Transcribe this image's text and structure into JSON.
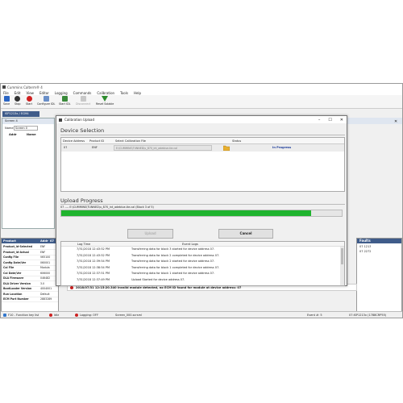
{
  "app": {
    "title": "Cummins Calterm® 4",
    "menu": [
      "File",
      "Edit",
      "View",
      "Editor",
      "Logging",
      "Commands",
      "Calibration",
      "Tools",
      "Help"
    ],
    "toolbar": [
      {
        "label": "Save",
        "color": "#2c66c4"
      },
      {
        "label": "Stop",
        "color": "#333333"
      },
      {
        "label": "Start",
        "color": "#d02020"
      },
      {
        "label": "Configure IDL",
        "color": "#6a8fc8"
      },
      {
        "label": "Start IDL",
        "color": "#3a8a3a"
      },
      {
        "label": "Disconnect",
        "color": "#b0b0b0"
      },
      {
        "label": "Reset Solable",
        "color": "#2e8b2e"
      }
    ]
  },
  "connection_tab": "ISP1213x / ECM4",
  "screen_panel": {
    "tab": "Screen 4",
    "name_label": "Name",
    "name_value": "Screen 0",
    "col_addr": "Addr",
    "col_name": "Name"
  },
  "product_panel": {
    "header_left": "Product",
    "header_addr": "Addr",
    "header_val": "07",
    "rows": [
      {
        "k": "Product_Id-Selected",
        "v": "ENF"
      },
      {
        "k": "Product_Id-Actual",
        "v": "ENF"
      },
      {
        "k": "Config File",
        "v": "V65100"
      },
      {
        "k": "Config Date/Ver",
        "v": "060001"
      },
      {
        "k": "Cal File",
        "v": "Modula"
      },
      {
        "k": "Cal Date/Ver",
        "v": "606000"
      },
      {
        "k": "DLA Firmware",
        "v": "046482"
      },
      {
        "k": "DLA Driver Version",
        "v": "3.0"
      },
      {
        "k": "BootLoader Version",
        "v": "4004001"
      },
      {
        "k": "Run Location",
        "v": "Default"
      },
      {
        "k": "ECM Part Number",
        "v": "2883289"
      }
    ]
  },
  "faults": {
    "title": "Faults",
    "items": [
      "07 1213",
      "07 2272"
    ]
  },
  "event_strip": "2018/07/31 12:15:20.340   Invalid module detected, no ECM ID found for module at device address: 07",
  "status_bar": {
    "help": "F10 - Function key list",
    "idle": "Idle",
    "logging": "Logging: OFF",
    "screen": "Screen_000.scrsml",
    "event": "Event #: 5",
    "right": "07:ISP1213x (1788CRP55)"
  },
  "dialog": {
    "title": "Calibration Upload",
    "device_section": "Device Selection",
    "columns": [
      "Device Address",
      "Product ID",
      "Select Calibration File",
      "Status"
    ],
    "row": {
      "address": "07",
      "product": "ENF",
      "file": "E:\\CUMMINS\\TUNNED\\u_870_int_adeblue-tie.cal",
      "status": "In Progress"
    },
    "upload_section": "Upload Progress",
    "progress_text": "07 ---- E:\\CUMMINS\\TUNNED\\u_870_int_adeblue-tie.cal (Block 3 of 5)",
    "progress": 0.89,
    "upload_btn": "Upload",
    "cancel_btn": "Cancel",
    "log_headers": [
      "Log Time",
      "Event Logs"
    ],
    "logs": [
      {
        "t": "7/31/2018 12:43:52 PM",
        "e": "Transferring data for block 3 started for device address 07."
      },
      {
        "t": "7/31/2018 12:43:52 PM",
        "e": "Transferring data for block 2 completed for device address 07."
      },
      {
        "t": "7/31/2018 12:39:54 PM",
        "e": "Transferring data for block 2 started for device address 07."
      },
      {
        "t": "7/31/2018 12:38:54 PM",
        "e": "Transferring data for block 1 completed for device address 07."
      },
      {
        "t": "7/31/2018 12:37:51 PM",
        "e": "Transferring data for block 1 started for device address 07."
      },
      {
        "t": "7/31/2018 12:37:49 PM",
        "e": "Upload Started for device address 07."
      }
    ]
  }
}
